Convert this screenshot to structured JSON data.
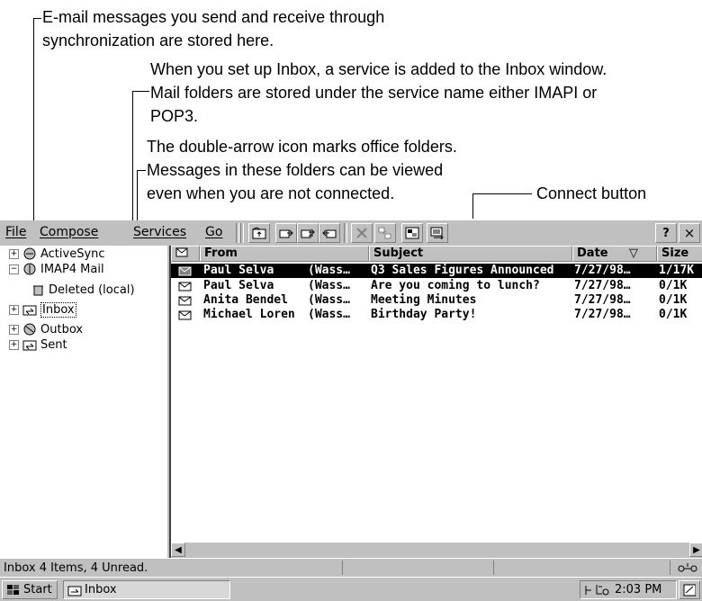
{
  "callouts": {
    "sync_line1": "E-mail messages you send and receive through",
    "sync_line2": "synchronization are stored here.",
    "service_line1": "When you set up Inbox, a service is added to the Inbox window.",
    "service_line2": "Mail folders are stored under the service name either IMAPI or",
    "service_line3": "POP3.",
    "office_line1": "The double-arrow icon marks office folders.",
    "office_line2": "Messages in these folders can be viewed",
    "office_line3": "even when you are not connected.",
    "connect": "Connect button"
  },
  "menu": {
    "file": "File",
    "compose": "Compose",
    "services": "Services",
    "go": "Go",
    "help": "?",
    "close": "×"
  },
  "toolbar_icons": [
    "folder-up-icon",
    "reply-icon",
    "reply-all-icon",
    "forward-icon",
    "delete-icon",
    "move-icon",
    "folder-icon",
    "connect-icon"
  ],
  "tree": {
    "activesync": "ActiveSync",
    "imap4": "IMAP4 Mail",
    "deleted": "Deleted (local)",
    "inbox": "Inbox",
    "outbox": "Outbox",
    "sent": "Sent"
  },
  "columns": {
    "from": "From",
    "subject": "Subject",
    "date": "Date",
    "sort": "▽",
    "size": "Size"
  },
  "messages": [
    {
      "from": "Paul Selva",
      "org": "(Wass…",
      "subject": "Q3 Sales Figures Announced",
      "date": "7/27/98…",
      "size": "1/17K"
    },
    {
      "from": "Paul Selva",
      "org": "(Wass…",
      "subject": "Are you coming to lunch?",
      "date": "7/27/98…",
      "size": "0/1K"
    },
    {
      "from": "Anita Bendel",
      "org": "(Wass…",
      "subject": "Meeting Minutes",
      "date": "7/27/98…",
      "size": "0/1K"
    },
    {
      "from": "Michael Loren",
      "org": "(Wass…",
      "subject": "Birthday Party!",
      "date": "7/27/98…",
      "size": "0/1K"
    }
  ],
  "status": {
    "text": "Inbox 4 Items, 4 Unread."
  },
  "taskbar": {
    "start": "Start",
    "task": "Inbox",
    "clock": "2:03 PM"
  }
}
